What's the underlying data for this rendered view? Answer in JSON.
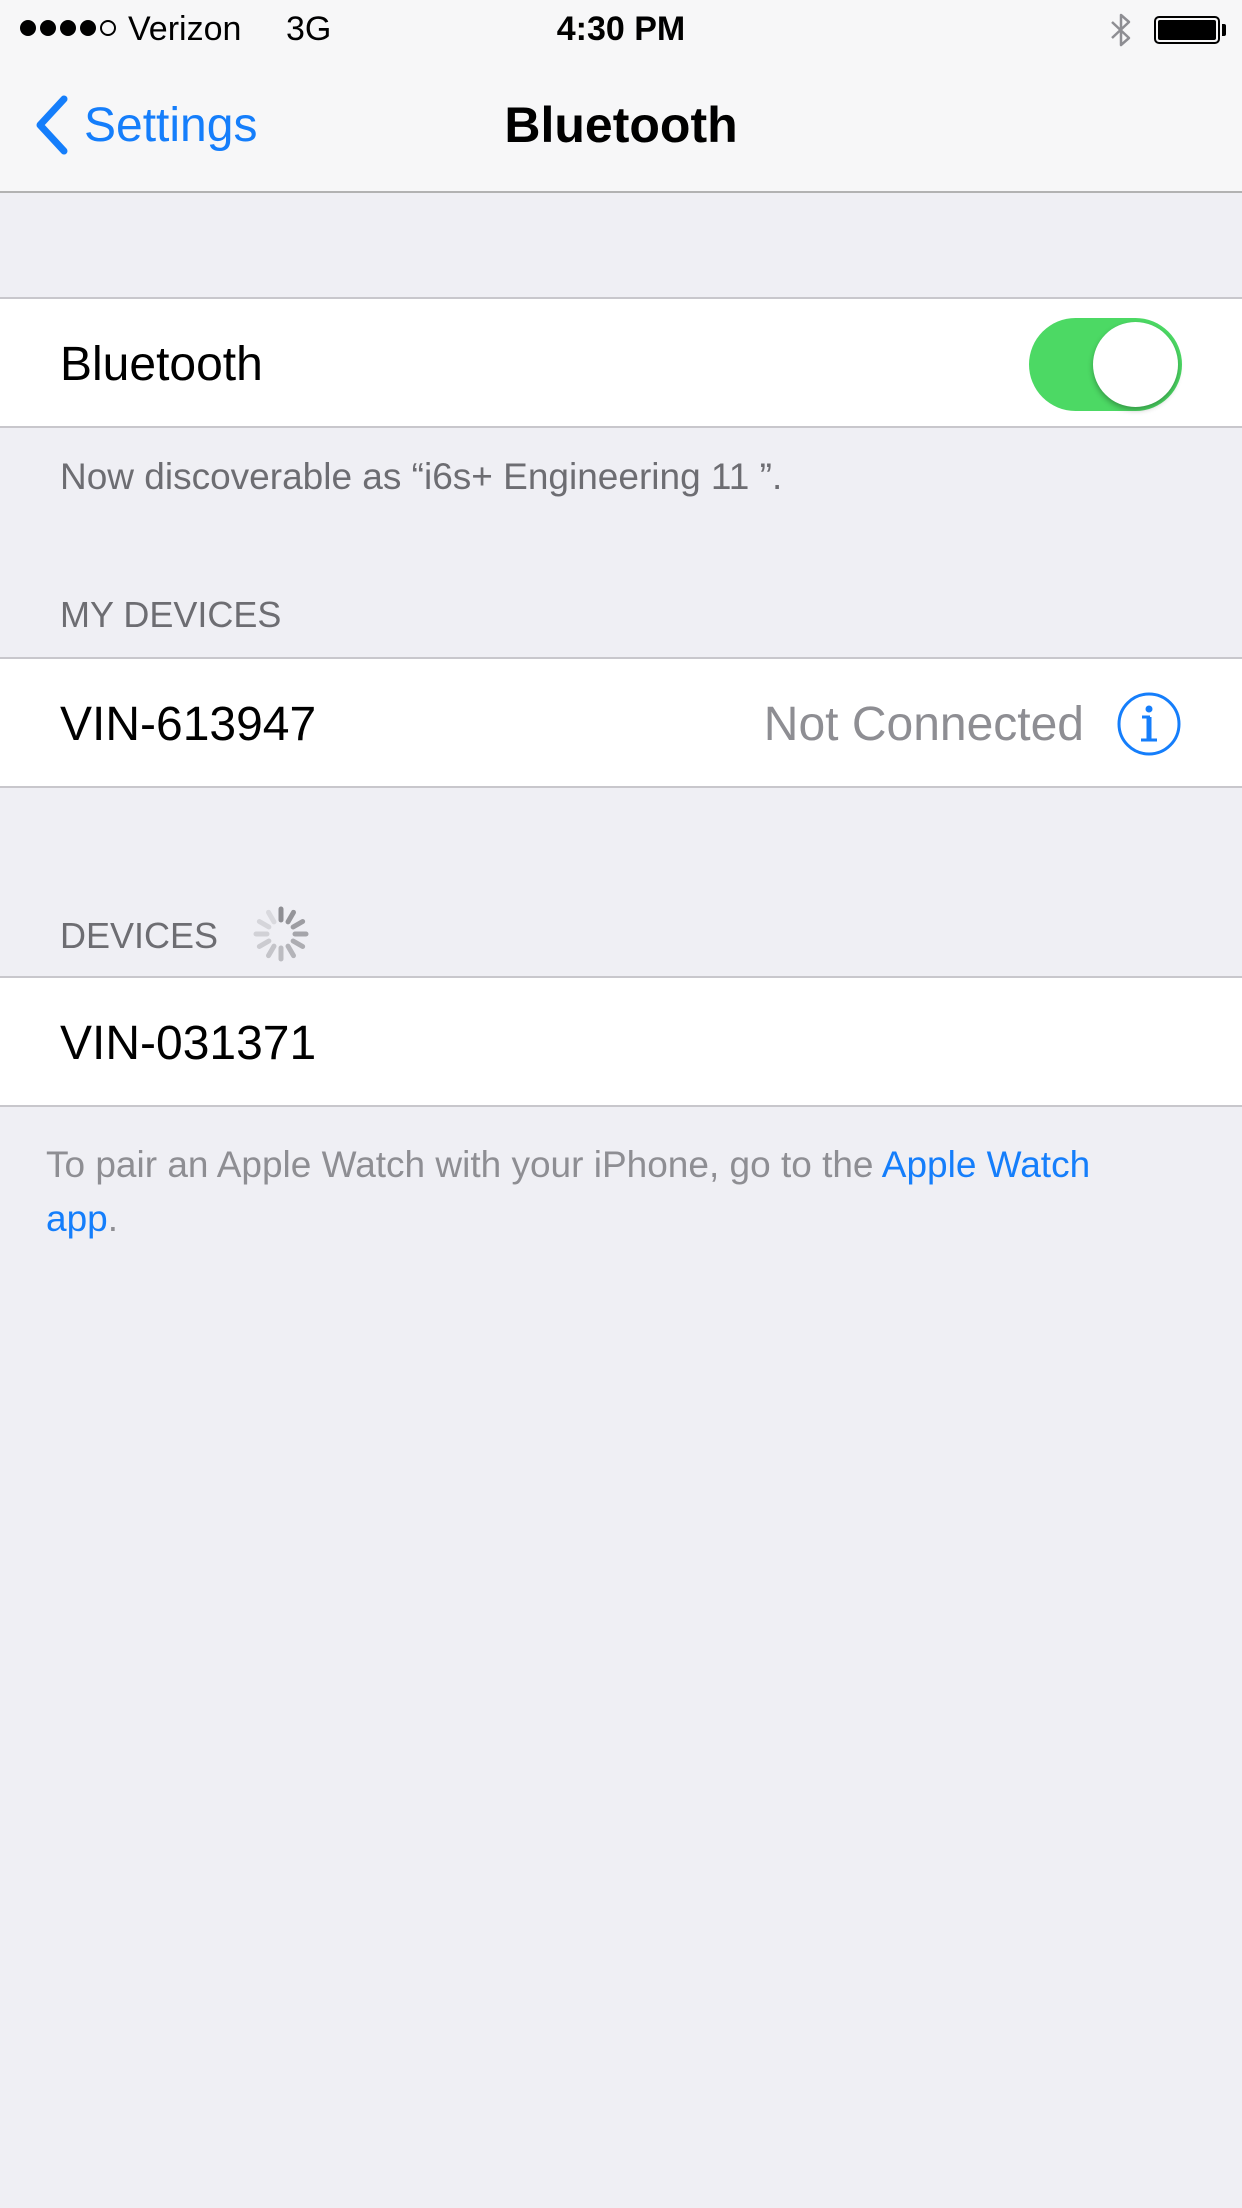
{
  "status_bar": {
    "signal_bars": 4,
    "signal_total": 5,
    "carrier": "Verizon",
    "network": "3G",
    "time": "4:30 PM",
    "battery_level": 1.0
  },
  "nav": {
    "back_label": "Settings",
    "title": "Bluetooth"
  },
  "bluetooth_toggle": {
    "label": "Bluetooth",
    "on": true
  },
  "discoverable_text": "Now discoverable as “i6s+ Engineering 11 ”.",
  "my_devices": {
    "header": "MY DEVICES",
    "items": [
      {
        "name": "VIN-613947",
        "status": "Not Connected"
      }
    ]
  },
  "devices": {
    "header": "DEVICES",
    "items": [
      {
        "name": "VIN-031371"
      }
    ]
  },
  "pair_note": {
    "text": "To pair an Apple Watch with your iPhone, go to the ",
    "link": "Apple Watch app",
    "end": "."
  },
  "colors": {
    "accent": "#157efb",
    "toggle_on": "#4cd964",
    "background": "#efeff4"
  }
}
